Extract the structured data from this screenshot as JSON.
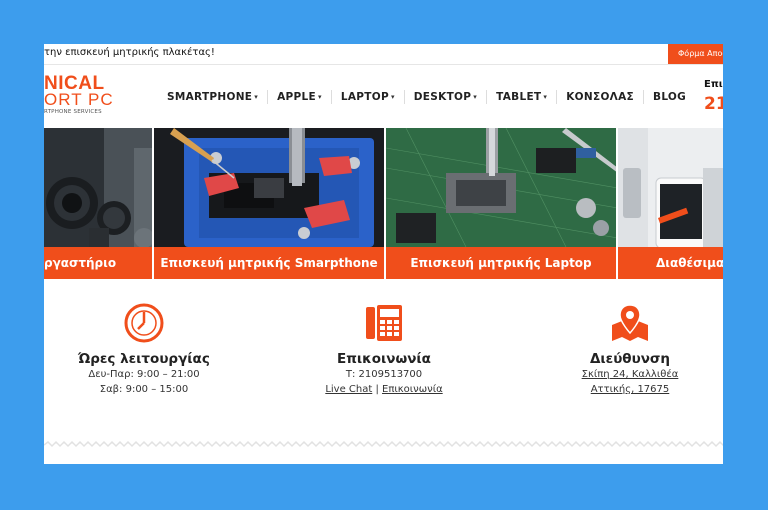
{
  "topbar": {
    "message": "την επισκευή μητρικής πλακέτας!",
    "form_button": "Φόρμα Αποσ"
  },
  "logo": {
    "line1": "NICAL",
    "line2": "ORT PC",
    "line3": "RTPHONE SERVICES"
  },
  "nav": {
    "items": [
      {
        "label": "SMARTPHONE",
        "dropdown": true
      },
      {
        "label": "APPLE",
        "dropdown": true
      },
      {
        "label": "LAPTOP",
        "dropdown": true
      },
      {
        "label": "DESKTOP",
        "dropdown": true
      },
      {
        "label": "TABLET",
        "dropdown": true
      },
      {
        "label": "ΚΟΝΣΟΛΑΣ",
        "dropdown": false
      },
      {
        "label": "BLOG",
        "dropdown": false
      }
    ]
  },
  "header_phone": {
    "title": "Επι",
    "number": "21"
  },
  "slides": [
    {
      "caption": "ργαστήριο"
    },
    {
      "caption": "Επισκευή μητρικής Smarpthone"
    },
    {
      "caption": "Επισκευή μητρικής Laptop"
    },
    {
      "caption": "Διαθέσιμα"
    }
  ],
  "features": {
    "hours": {
      "title": "Ώρες λειτουργίας",
      "line1": "Δευ-Παρ: 9:00 – 21:00",
      "line2": "Σαβ: 9:00 – 15:00"
    },
    "contact": {
      "title": "Επικοινωνία",
      "phone": "Τ: 2109513700",
      "live_chat": "Live Chat",
      "separator": "|",
      "contact_link": "Επικοινωνία"
    },
    "address": {
      "title": "Διεύθυνση",
      "line1": "Σκίπη 24, Καλλιθέα",
      "line2": "Αττικής, 17675"
    }
  },
  "colors": {
    "accent": "#f04e1b",
    "background": "#3d9ded"
  }
}
